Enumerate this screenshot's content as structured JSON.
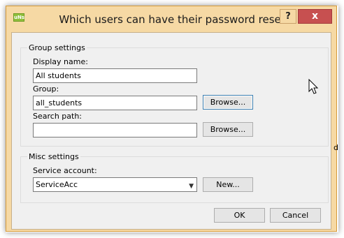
{
  "window": {
    "title": "Which users can have their password reset",
    "app_icon": "uNs",
    "help_label": "?",
    "close_label": "x"
  },
  "group_settings": {
    "legend": "Group settings",
    "display_name_label": "Display name:",
    "display_name_value": "All students",
    "group_label": "Group:",
    "group_value": "all_students",
    "browse_group_label": "Browse...",
    "search_path_label": "Search path:",
    "search_path_value": "",
    "browse_search_label": "Browse..."
  },
  "misc_settings": {
    "legend": "Misc settings",
    "service_account_label": "Service account:",
    "service_account_value": "ServiceAcc",
    "new_label": "New..."
  },
  "footer": {
    "ok_label": "OK",
    "cancel_label": "Cancel"
  },
  "background": {
    "fragment": "d"
  },
  "icons": [
    "app-icon",
    "help-icon",
    "close-icon",
    "chevron-down-icon",
    "mouse-cursor-icon"
  ],
  "colors": {
    "title_bar": "#f6d9a4",
    "close_button": "#c75050",
    "client_bg": "#f0f0f0",
    "focus_border": "#3c7fb1"
  }
}
